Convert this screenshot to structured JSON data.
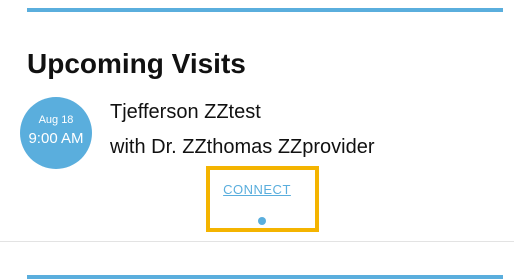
{
  "section": {
    "title": "Upcoming Visits"
  },
  "visit": {
    "date": "Aug 18",
    "time": "9:00 AM",
    "patient": "Tjefferson ZZtest",
    "provider_line": "with Dr. ZZthomas ZZprovider",
    "connect_label": "CONNECT"
  },
  "colors": {
    "accent": "#5aaedd",
    "highlight": "#f4b400",
    "text": "#111111"
  }
}
